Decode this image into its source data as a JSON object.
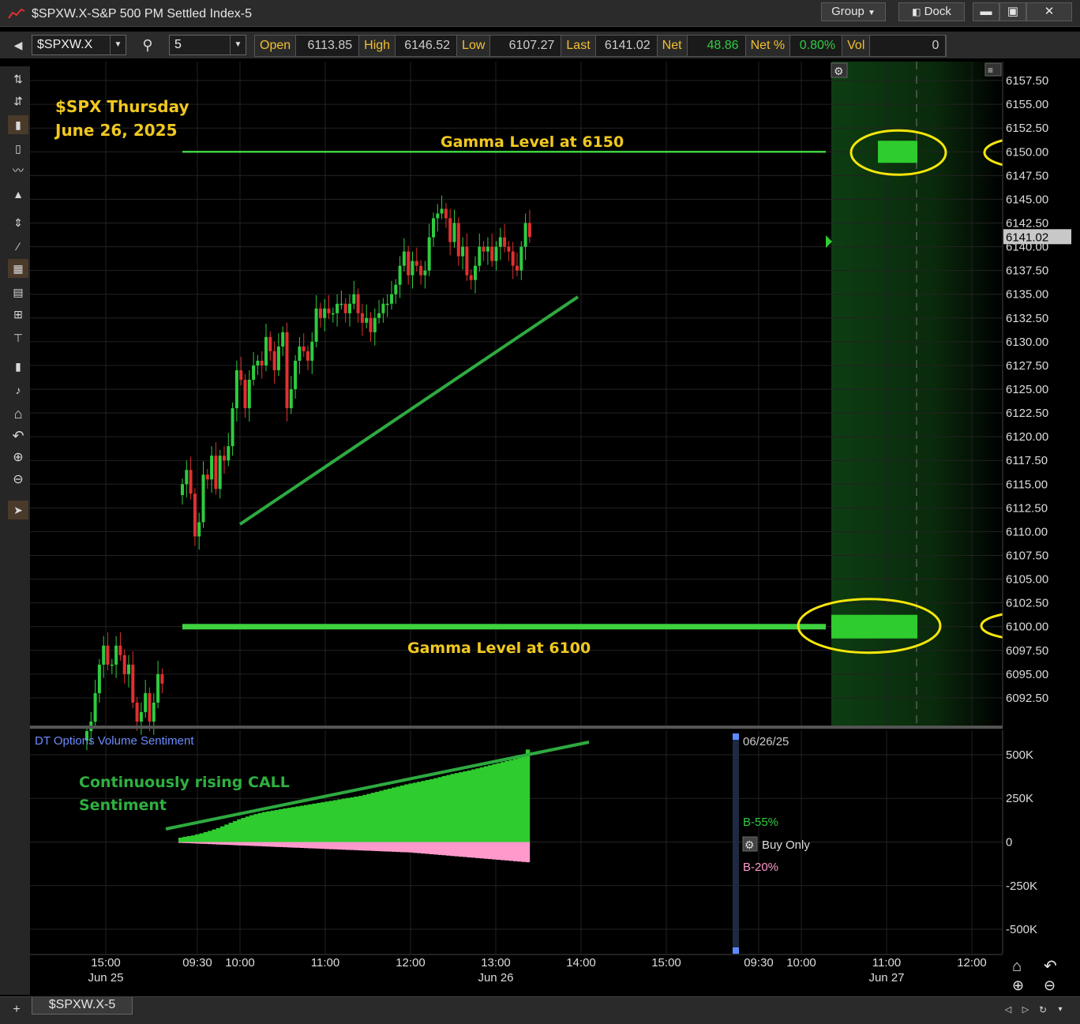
{
  "window": {
    "title": "$SPXW.X-S&P 500 PM Settled Index-5",
    "group_label": "Group",
    "dock_label": "Dock"
  },
  "toolbar": {
    "symbol": "$SPXW.X",
    "interval": "5",
    "quote": [
      {
        "label": "Open",
        "value": "6113.85"
      },
      {
        "label": "High",
        "value": "6146.52"
      },
      {
        "label": "Low",
        "value": "6107.27"
      },
      {
        "label": "Last",
        "value": "6141.02"
      },
      {
        "label": "Net",
        "value": "48.86"
      },
      {
        "label": "Net %",
        "value": "0.80%"
      },
      {
        "label": "Vol",
        "value": "0"
      }
    ]
  },
  "colors": {
    "up": "#2ecc40",
    "down": "#e03030",
    "annotation": "#f0c820",
    "sentiment_buy": "#2ecc2e",
    "sentiment_sell": "#ff99cc",
    "gamma_line": "#3fd13f",
    "trend_line": "#2eaa40"
  },
  "annotations": {
    "title_line1": "$SPX Thursday",
    "title_line2": "June 26, 2025",
    "gamma_upper": "Gamma Level at 6150",
    "gamma_lower": "Gamma Level at 6100",
    "sentiment_line1": "Continuously rising CALL",
    "sentiment_line2": "Sentiment"
  },
  "chart_data": [
    {
      "type": "candlestick",
      "y_ticks": [
        "6157.50",
        "6155.00",
        "6152.50",
        "6150.00",
        "6147.50",
        "6145.00",
        "6142.50",
        "6140.00",
        "6137.50",
        "6135.00",
        "6132.50",
        "6130.00",
        "6127.50",
        "6125.00",
        "6122.50",
        "6120.00",
        "6117.50",
        "6115.00",
        "6112.50",
        "6110.00",
        "6107.50",
        "6105.00",
        "6102.50",
        "6100.00",
        "6097.50",
        "6095.00",
        "6092.50"
      ],
      "ylim": [
        6089.5,
        6159.5
      ],
      "last_price_label": "6141.02",
      "gamma_levels": [
        6150,
        6100
      ],
      "x_labels": [
        {
          "time": "15:00",
          "date": "Jun 25"
        },
        {
          "time": "09:30",
          "date": ""
        },
        {
          "time": "10:00",
          "date": ""
        },
        {
          "time": "11:00",
          "date": ""
        },
        {
          "time": "12:00",
          "date": ""
        },
        {
          "time": "13:00",
          "date": "Jun 26"
        },
        {
          "time": "14:00",
          "date": ""
        },
        {
          "time": "15:00",
          "date": ""
        },
        {
          "time": "09:30",
          "date": ""
        },
        {
          "time": "10:00",
          "date": ""
        },
        {
          "time": "11:00",
          "date": "Jun 27"
        },
        {
          "time": "12:00",
          "date": ""
        }
      ],
      "jun25_closes": [
        6089,
        6090,
        6093,
        6096,
        6098,
        6096,
        6096,
        6098,
        6097,
        6095,
        6096,
        6092,
        6090,
        6091,
        6093,
        6090,
        6092,
        6095,
        6094
      ],
      "jun26_closes": [
        6115,
        6116.5,
        6114,
        6109.5,
        6111,
        6116,
        6115.5,
        6118,
        6114.5,
        6118,
        6117.5,
        6119,
        6123,
        6127,
        6126,
        6123,
        6126,
        6127.5,
        6128,
        6127.5,
        6130.5,
        6129,
        6127,
        6129.5,
        6131,
        6123,
        6125,
        6128,
        6129.5,
        6129,
        6128,
        6130,
        6133.5,
        6132.5,
        6133.5,
        6133,
        6133,
        6134,
        6134,
        6133,
        6134,
        6135,
        6133,
        6132,
        6132.5,
        6131,
        6132.5,
        6133,
        6134,
        6134,
        6135,
        6136,
        6138,
        6139.5,
        6137,
        6138.5,
        6138,
        6137,
        6137.5,
        6141,
        6143,
        6143.5,
        6144,
        6143,
        6140.5,
        6142.5,
        6139,
        6140,
        6137,
        6136.5,
        6138,
        6140,
        6139.5,
        6140,
        6138.5,
        6140,
        6141,
        6140,
        6139.5,
        6138,
        6137.5,
        6140,
        6142.5,
        6141.02
      ]
    },
    {
      "type": "area",
      "title": "DT Options Volume Sentiment",
      "y_ticks": [
        "500K",
        "250K",
        "0",
        "-250K",
        "-500K"
      ],
      "ylim": [
        -640000,
        640000
      ],
      "date_label": "06/26/25",
      "buy_label": "B-55%",
      "sell_label": "B-20%",
      "mode_label": "Buy Only",
      "buy_series": [
        25000,
        30000,
        34000,
        38000,
        44000,
        50000,
        57000,
        64000,
        72000,
        80000,
        90000,
        100000,
        110000,
        120000,
        130000,
        138000,
        146000,
        154000,
        160000,
        166000,
        172000,
        176000,
        180000,
        184000,
        188000,
        192000,
        196000,
        200000,
        204000,
        208000,
        212000,
        216000,
        220000,
        224000,
        228000,
        232000,
        236000,
        240000,
        244000,
        248000,
        252000,
        256000,
        260000,
        264000,
        270000,
        276000,
        282000,
        288000,
        294000,
        300000,
        306000,
        312000,
        318000,
        324000,
        330000,
        335000,
        340000,
        345000,
        350000,
        355000,
        360000,
        366000,
        372000,
        378000,
        384000,
        390000,
        395000,
        400000,
        405000,
        410000,
        416000,
        422000,
        428000,
        434000,
        440000,
        446000,
        452000,
        458000,
        464000,
        470000,
        476000,
        482000,
        490000,
        530000
      ],
      "sell_series": [
        -5000,
        -6000,
        -7000,
        -8000,
        -9000,
        -10000,
        -11000,
        -12000,
        -13000,
        -14000,
        -15000,
        -16000,
        -17000,
        -18000,
        -19000,
        -20000,
        -21000,
        -22000,
        -23000,
        -24000,
        -25000,
        -26000,
        -27000,
        -28000,
        -29000,
        -30000,
        -31000,
        -32000,
        -33000,
        -34000,
        -35000,
        -36000,
        -37000,
        -38000,
        -39000,
        -40000,
        -41000,
        -42000,
        -43000,
        -44000,
        -45000,
        -46000,
        -47000,
        -48000,
        -49000,
        -50000,
        -51000,
        -52000,
        -53000,
        -54000,
        -55000,
        -56000,
        -57000,
        -58000,
        -59000,
        -60000,
        -62000,
        -64000,
        -66000,
        -68000,
        -70000,
        -72000,
        -74000,
        -76000,
        -78000,
        -80000,
        -82000,
        -84000,
        -86000,
        -88000,
        -90000,
        -92000,
        -94000,
        -96000,
        -98000,
        -100000,
        -102000,
        -104000,
        -106000,
        -108000,
        -110000,
        -112000,
        -114000,
        -116000
      ]
    }
  ],
  "bottom": {
    "tab_label": "$SPXW.X-5"
  }
}
